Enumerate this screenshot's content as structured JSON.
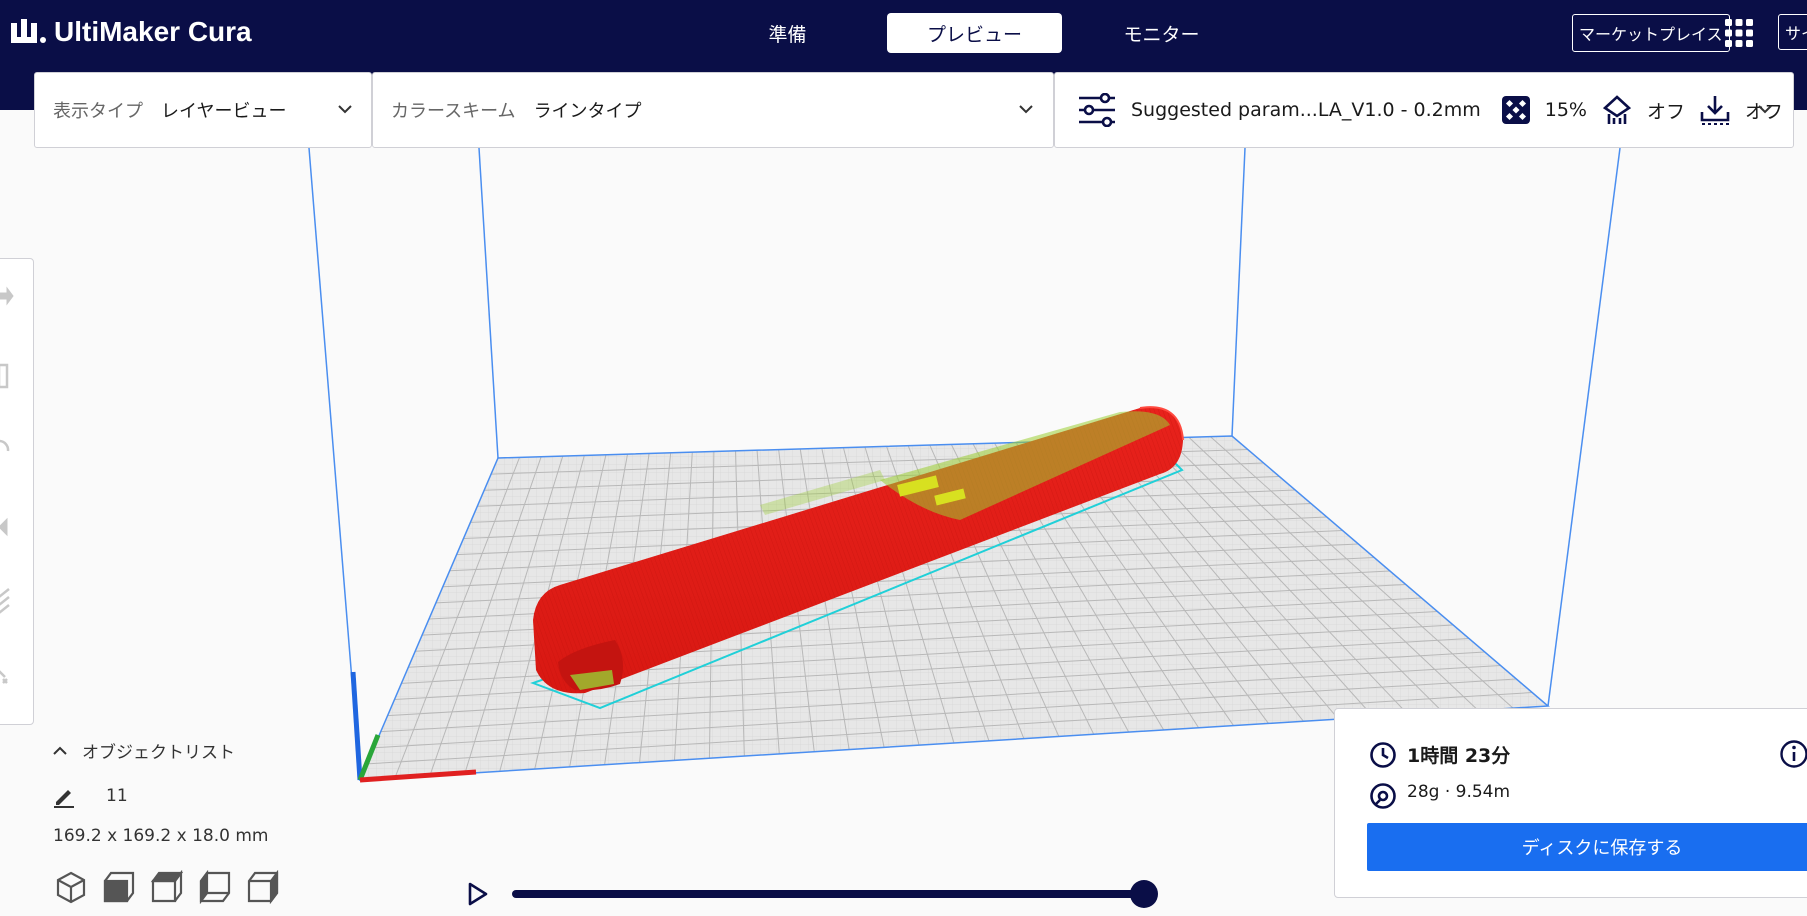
{
  "app": {
    "name": "UltiMaker Cura"
  },
  "header": {
    "tabs": [
      {
        "label": "準備",
        "active": false
      },
      {
        "label": "プレビュー",
        "active": true
      },
      {
        "label": "モニター",
        "active": false
      }
    ],
    "marketplace_label": "マーケットプレイス",
    "signin_label": "サイ"
  },
  "view_type": {
    "label": "表示タイプ",
    "value": "レイヤービュー"
  },
  "color_scheme": {
    "label": "カラースキーム",
    "value": "ラインタイプ"
  },
  "print_setup": {
    "profile": "Suggested param...LA_V1.0 - 0.2mm",
    "infill": "15%",
    "support": "オフ",
    "adhesion": "オフ"
  },
  "object_list": {
    "title": "オブジェクトリスト",
    "object_name": "11",
    "dimensions": "169.2 x 169.2 x 18.0 mm"
  },
  "print_info": {
    "time": "1時間 23分",
    "material": "28g · 9.54m",
    "save_label": "ディスクに保存する"
  },
  "layer_slider": {
    "value": 1.0
  },
  "colors": {
    "header_bg": "#0a0e47",
    "accent_blue": "#196ef0",
    "model_red": "#e8221c",
    "infill_green": "#9acd32",
    "skirt_cyan": "#20d0d8"
  },
  "icons": {
    "print_settings": "sliders-icon",
    "infill": "infill-icon",
    "support": "support-icon",
    "adhesion": "adhesion-icon",
    "time": "clock-icon",
    "material": "spool-icon",
    "info": "info-icon"
  }
}
